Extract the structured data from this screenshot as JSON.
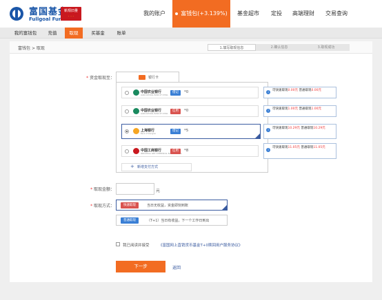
{
  "header": {
    "brand_cn": "富国基金",
    "brand_en": "Fullgoal Fund",
    "badge_line1": "新规旧量",
    "badge_line2": "· · ·"
  },
  "topnav": {
    "account": "我的账户",
    "wallet": "富钱包(+3.139%)",
    "market": "基金超市",
    "fixed": "定投",
    "premium": "高端理财",
    "query": "交易查询"
  },
  "subnav": {
    "my_wallet": "我的富钱包",
    "deposit": "充值",
    "withdraw": "取现",
    "buy_fund": "买基金",
    "bill": "账单"
  },
  "breadcrumb": {
    "root": "富钱包",
    "sep": ">",
    "current": "取现"
  },
  "steps": [
    "1.填写取现信息",
    "2.确认信息",
    "3.取现成功"
  ],
  "form": {
    "receive_label": "资金取现至：",
    "req": "*",
    "tab_label": "银行卡",
    "cards": [
      {
        "bank": "中国农业银行",
        "bank_en": "AGRICULTURAL BANK OF CHINA",
        "type": "借记",
        "number": "*0",
        "quota": {
          "fast_label": "可快速取现",
          "fast": "0.00元",
          "normal_label": "普通取现",
          "normal": "0.00元"
        },
        "selected": false,
        "logo": "#1a8a5f",
        "type_color": "#3a7fd5"
      },
      {
        "bank": "中国农业银行",
        "bank_en": "AGRICULTURAL BANK OF CHINA",
        "type": "信用",
        "number": "*0",
        "quota": {
          "fast_label": "可快速取现",
          "fast": "1.00元",
          "normal_label": "普通取现",
          "normal": "1.00元"
        },
        "selected": false,
        "logo": "#1a8a5f",
        "type_color": "#d9534f"
      },
      {
        "bank": "上海银行",
        "bank_en": "Bank of Shanghai",
        "type": "借记",
        "number": "*5",
        "quota": {
          "fast_label": "可快速取现",
          "fast": "10.29元",
          "normal_label": "普通取现",
          "normal": "10.29元"
        },
        "selected": true,
        "logo": "#f6a623",
        "type_color": "#3a7fd5"
      },
      {
        "bank": "中国工商银行",
        "bank_en": "INDUSTRIAL AND COMMERCIAL BANK OF CHINA",
        "type": "信用",
        "number": "*8",
        "quota": {
          "fast_label": "可快速取现",
          "fast": "11.05元",
          "normal_label": "普通取现",
          "normal": "11.05元"
        },
        "selected": false,
        "logo": "#c9181f",
        "type_color": "#d9534f"
      }
    ],
    "add_payment": "新增支付方式",
    "add_plus": "+",
    "amount_label": "取现金额：",
    "amount_value": "",
    "yuan": "元",
    "method_label": "取现方式：",
    "methods": [
      {
        "btn": "快速取现",
        "desc": "当日无收益，资金即刻到账",
        "selected": true,
        "color": "#d9534f"
      },
      {
        "btn": "普通取现",
        "desc": "（T+1）当日有收益，下一个工作日到出",
        "selected": false,
        "color": "#3a7fd5"
      }
    ],
    "agree_text": "我已阅读并接受",
    "agree_link": "《富国网上直销货币基金T+0赎回用户服务协议》",
    "next": "下一步",
    "back": "返回"
  }
}
